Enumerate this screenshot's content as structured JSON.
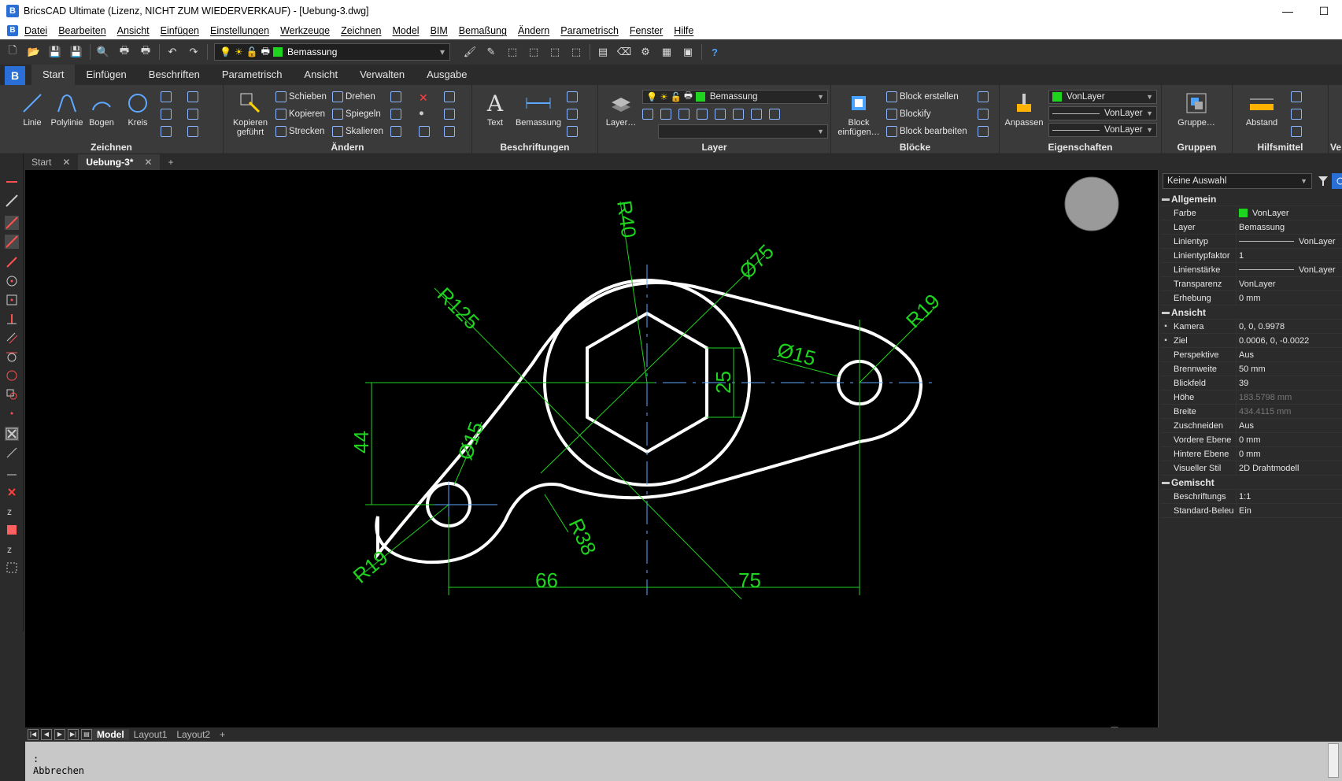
{
  "window": {
    "title": "BricsCAD Ultimate (Lizenz, NICHT ZUM WIEDERVERKAUF) - [Uebung-3.dwg]",
    "controls": [
      "—",
      "☐",
      "✕"
    ]
  },
  "menu": [
    "Datei",
    "Bearbeiten",
    "Ansicht",
    "Einfügen",
    "Einstellungen",
    "Werkzeuge",
    "Zeichnen",
    "Model",
    "BIM",
    "Bemaßung",
    "Ändern",
    "Parametrisch",
    "Fenster",
    "Hilfe"
  ],
  "qat": {
    "layer": "Bemassung",
    "layer_color": "#1fd41f"
  },
  "ribbon_tabs": [
    "Start",
    "Einfügen",
    "Beschriften",
    "Parametrisch",
    "Ansicht",
    "Verwalten",
    "Ausgabe"
  ],
  "ribbon": {
    "zeichnen": {
      "title": "Zeichnen",
      "linie": "Linie",
      "polylinie": "Polylinie",
      "bogen": "Bogen",
      "kreis": "Kreis"
    },
    "aendern": {
      "title": "Ändern",
      "kopieren_gefuehrt": "Kopieren geführt",
      "schieben": "Schieben",
      "kopieren": "Kopieren",
      "strecken": "Strecken",
      "drehen": "Drehen",
      "spiegeln": "Spiegeln",
      "skalieren": "Skalieren"
    },
    "beschriftungen": {
      "title": "Beschriftungen",
      "text": "Text",
      "bemassung": "Bemassung"
    },
    "layer": {
      "title": "Layer",
      "layer_btn": "Layer…",
      "current": "Bemassung"
    },
    "bloecke": {
      "title": "Blöcke",
      "einfuegen": "Block einfügen…",
      "erstellen": "Block erstellen",
      "blockify": "Blockify",
      "bearbeiten": "Block bearbeiten"
    },
    "eigenschaften": {
      "title": "Eigenschaften",
      "anpassen": "Anpassen",
      "color": "VonLayer",
      "linetype": "VonLayer",
      "lineweight": "VonLayer"
    },
    "gruppen": {
      "title": "Gruppen",
      "btn": "Gruppe…"
    },
    "hilfsmittel": {
      "title": "Hilfsmittel",
      "abstand": "Abstand"
    },
    "more": "Ve"
  },
  "doc_tabs": [
    {
      "label": "Start"
    },
    {
      "label": "Uebung-3*"
    }
  ],
  "drawing": {
    "dims": {
      "r40": "R40",
      "d75": "Ø75",
      "r125": "R125",
      "r19_right": "R19",
      "d15_right": "Ø15",
      "d25": "25",
      "d44": "44",
      "d15_left": "Ø15",
      "r19_left": "R19",
      "r38": "R38",
      "d66": "66",
      "d75_bottom": "75"
    },
    "line_color": "#ffffff",
    "dim_color": "#1fd41f"
  },
  "properties": {
    "selection": "Keine Auswahl",
    "allgemein": {
      "title": "Allgemein",
      "rows": [
        {
          "label": "Farbe",
          "value": "VonLayer"
        },
        {
          "label": "Layer",
          "value": "Bemassung"
        },
        {
          "label": "Linientyp",
          "value": "VonLayer"
        },
        {
          "label": "Linientypfaktor",
          "value": "1"
        },
        {
          "label": "Linienstärke",
          "value": "VonLayer"
        },
        {
          "label": "Transparenz",
          "value": "VonLayer"
        },
        {
          "label": "Erhebung",
          "value": "0 mm"
        }
      ]
    },
    "ansicht": {
      "title": "Ansicht",
      "rows": [
        {
          "label": "Kamera",
          "value": "0, 0, 0.9978"
        },
        {
          "label": "Ziel",
          "value": "0.0006, 0, -0.0022"
        },
        {
          "label": "Perspektive",
          "value": "Aus"
        },
        {
          "label": "Brennweite",
          "value": "50 mm"
        },
        {
          "label": "Blickfeld",
          "value": "39"
        },
        {
          "label": "Höhe",
          "value": "183.5798 mm"
        },
        {
          "label": "Breite",
          "value": "434.4115 mm"
        },
        {
          "label": "Zuschneiden",
          "value": "Aus"
        },
        {
          "label": "Vordere Ebene",
          "value": "0 mm"
        },
        {
          "label": "Hintere Ebene",
          "value": "0 mm"
        },
        {
          "label": "Visueller Stil",
          "value": "2D Drahtmodell"
        }
      ]
    },
    "gemischt": {
      "title": "Gemischt",
      "rows": [
        {
          "label": "Beschriftungs",
          "value": "1:1"
        },
        {
          "label": "Standard-Beleu",
          "value": "Ein"
        }
      ]
    }
  },
  "layout_tabs": [
    "Model",
    "Layout1",
    "Layout2"
  ],
  "command_line": [
    ": ",
    "Abbrechen"
  ]
}
